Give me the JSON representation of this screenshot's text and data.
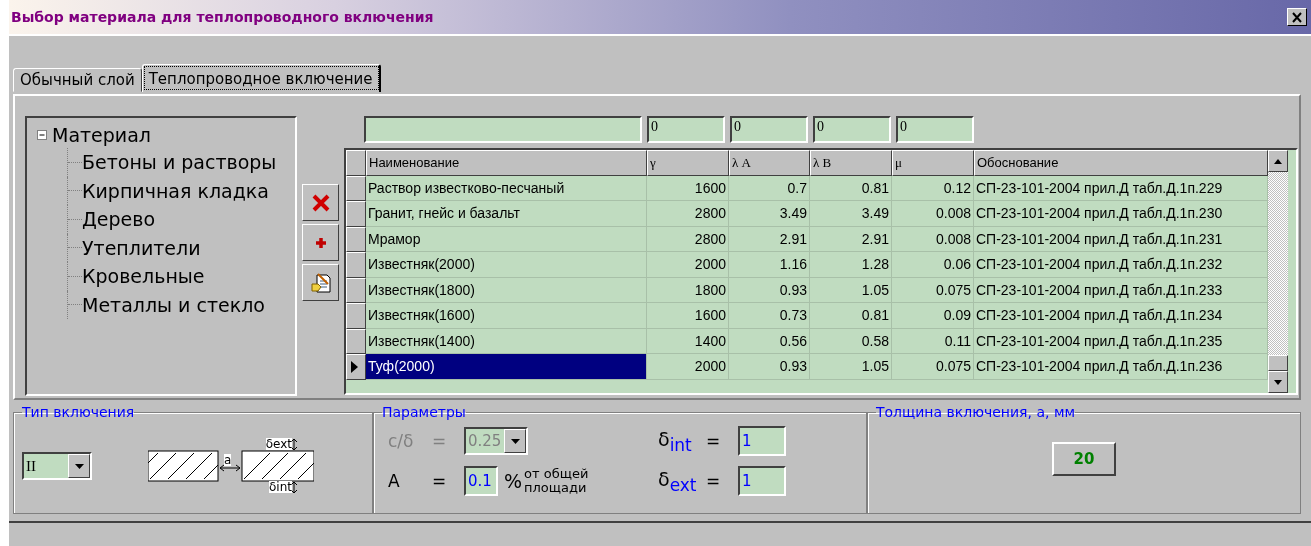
{
  "window": {
    "title": "Выбор материала для теплопроводного включения"
  },
  "tabs": [
    {
      "label": "Обычный слой",
      "selected": false
    },
    {
      "label": "Теплопроводное включение",
      "selected": true
    }
  ],
  "tree": {
    "label": "Материал",
    "expanded": true,
    "children": [
      {
        "label": "Бетоны и растворы"
      },
      {
        "label": "Кирпичная кладка"
      },
      {
        "label": "Дерево"
      },
      {
        "label": "Утеплители"
      },
      {
        "label": "Кровельные"
      },
      {
        "label": "Металлы и стекло"
      }
    ]
  },
  "filters": [
    "0",
    "0",
    "0",
    "0"
  ],
  "table": {
    "columns": [
      "Наименование",
      "γ",
      "λ A",
      "λ B",
      "μ",
      "Обоснование"
    ],
    "rows": [
      {
        "cells": [
          "Раствор известково-песчаный",
          "1600",
          "0.7",
          "0.81",
          "0.12",
          "СП-23-101-2004 прил.Д табл.Д.1п.229"
        ],
        "selected": false
      },
      {
        "cells": [
          "Гранит, гнейс и базальт",
          "2800",
          "3.49",
          "3.49",
          "0.008",
          "СП-23-101-2004 прил.Д табл.Д.1п.230"
        ],
        "selected": false
      },
      {
        "cells": [
          "Мрамор",
          "2800",
          "2.91",
          "2.91",
          "0.008",
          "СП-23-101-2004 прил.Д табл.Д.1п.231"
        ],
        "selected": false
      },
      {
        "cells": [
          "Известняк(2000)",
          "2000",
          "1.16",
          "1.28",
          "0.06",
          "СП-23-101-2004 прил.Д табл.Д.1п.232"
        ],
        "selected": false
      },
      {
        "cells": [
          "Известняк(1800)",
          "1800",
          "0.93",
          "1.05",
          "0.075",
          "СП-23-101-2004 прил.Д табл.Д.1п.233"
        ],
        "selected": false
      },
      {
        "cells": [
          "Известняк(1600)",
          "1600",
          "0.73",
          "0.81",
          "0.09",
          "СП-23-101-2004 прил.Д табл.Д.1п.234"
        ],
        "selected": false
      },
      {
        "cells": [
          "Известняк(1400)",
          "1400",
          "0.56",
          "0.58",
          "0.11",
          "СП-23-101-2004 прил.Д табл.Д.1п.235"
        ],
        "selected": false
      },
      {
        "cells": [
          "Туф(2000)",
          "2000",
          "0.93",
          "1.05",
          "0.075",
          "СП-23-101-2004 прил.Д табл.Д.1п.236"
        ],
        "selected": true
      }
    ]
  },
  "inclusion_type": {
    "title": "Тип включения",
    "value": "II",
    "diagram": {
      "ext": "δext",
      "int": "δint",
      "gap": "a"
    }
  },
  "parameters": {
    "title": "Параметры",
    "c_delta": {
      "label": "c/δ",
      "eq": "=",
      "value": "0.25",
      "disabled": true
    },
    "area": {
      "label": "A",
      "eq": "=",
      "value": "0.1",
      "unit": "%",
      "note": "от общей площади"
    },
    "delta_int": {
      "label": "δ$_{int}$",
      "eq": "=",
      "value": "1"
    },
    "delta_ext": {
      "label": "δ$_{ext}$",
      "eq": "=",
      "value": "1"
    }
  },
  "thickness": {
    "title": "Толщина включения, а, мм",
    "value": "20"
  }
}
